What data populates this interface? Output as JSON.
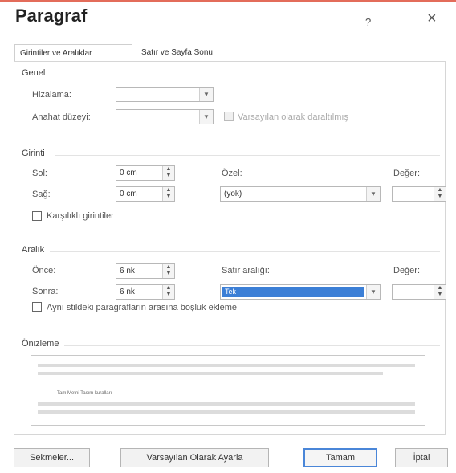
{
  "dialog": {
    "title": "Paragraf",
    "help": "?",
    "close": "×"
  },
  "tabs": [
    {
      "label": "Girintiler ve Aralıklar"
    },
    {
      "label": "Satır ve Sayfa Sonu"
    }
  ],
  "genel": {
    "section": "Genel",
    "alignment_label": "Hizalama:",
    "alignment_value": "",
    "outline_label": "Anahat düzeyi:",
    "outline_value": "",
    "collapsed_label": "Varsayılan olarak daraltılmış"
  },
  "girinti": {
    "section": "Girinti",
    "left_label": "Sol:",
    "left_value": "0 cm",
    "right_label": "Sağ:",
    "right_value": "0 cm",
    "special_label": "Özel:",
    "special_value": "(yok)",
    "by_label": "Değer:",
    "by_value": "",
    "mirror_label": "Karşılıklı girintiler"
  },
  "aralik": {
    "section": "Aralık",
    "before_label": "Önce:",
    "before_value": "6 nk",
    "after_label": "Sonra:",
    "after_value": "6 nk",
    "line_spacing_label": "Satır aralığı:",
    "line_spacing_value": "Tek",
    "at_label": "Değer:",
    "at_value": "",
    "no_space_label": "Aynı stildeki paragrafların arasına boşluk ekleme"
  },
  "onizleme": {
    "section": "Önizleme",
    "sample_text": "Tam Metni Tasım kuralları"
  },
  "buttons": {
    "tabs": "Sekmeler...",
    "default": "Varsayılan Olarak Ayarla",
    "ok": "Tamam",
    "cancel": "İptal"
  }
}
